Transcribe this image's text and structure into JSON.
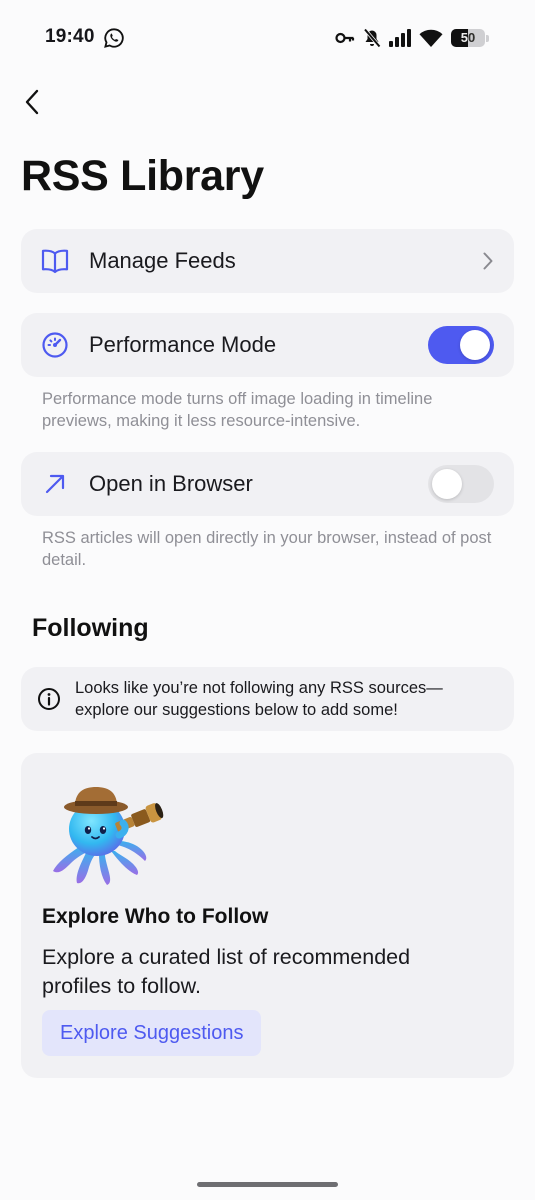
{
  "status_bar": {
    "time": "19:40",
    "battery_level": "50",
    "icons": [
      "whatsapp-icon",
      "key-icon",
      "mute-icon",
      "signal-icon",
      "wifi-icon",
      "battery-icon"
    ]
  },
  "nav": {
    "back_icon": "chevron-left-icon"
  },
  "page": {
    "title": "RSS Library"
  },
  "settings": {
    "manage_feeds": {
      "label": "Manage Feeds",
      "icon": "book-icon",
      "trailing_icon": "chevron-right-icon"
    },
    "performance_mode": {
      "label": "Performance Mode",
      "icon": "speedometer-icon",
      "enabled": true,
      "description": "Performance mode turns off image loading in timeline previews, making it less resource-intensive."
    },
    "open_in_browser": {
      "label": "Open in Browser",
      "icon": "arrow-up-right-icon",
      "enabled": false,
      "description": "RSS articles will open directly in your browser, instead of post detail."
    }
  },
  "following": {
    "title": "Following",
    "info_icon": "info-icon",
    "empty_message": "Looks like you’re not following any RSS sources—explore our suggestions below to add some!"
  },
  "explore": {
    "image": "octopus-explorer-mascot",
    "title": "Explore Who to Follow",
    "description": "Explore a curated list of recommended profiles to follow.",
    "button_label": "Explore Suggestions"
  },
  "colors": {
    "accent": "#4e5af0",
    "background": "#fbfbfc",
    "card": "#f1f1f4",
    "helper_text": "#8f8f96",
    "button_tint": "#e3e5fb"
  }
}
